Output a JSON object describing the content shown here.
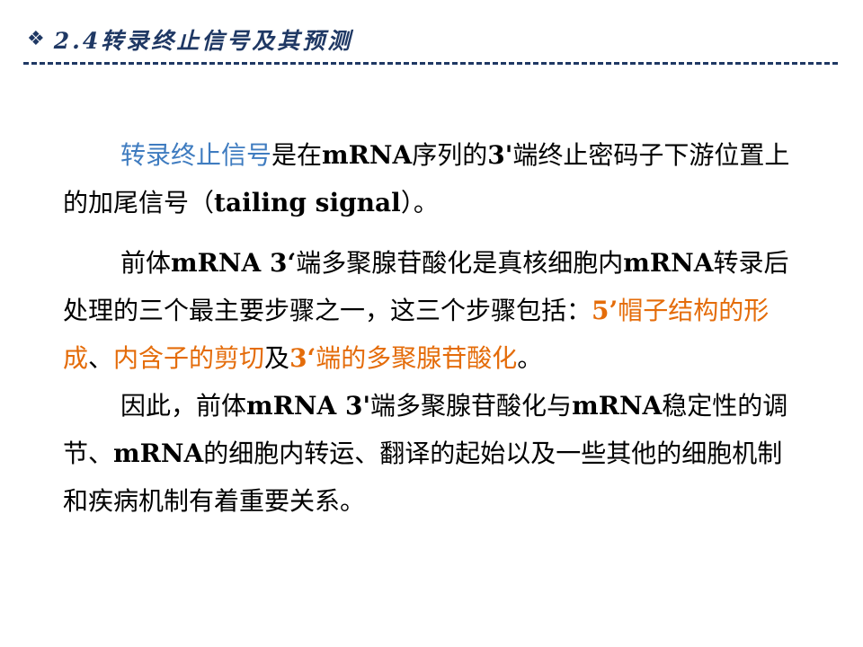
{
  "header": {
    "bullet_icon": "diamond-bullet-icon",
    "title": "2.4转录终止信号及其预测"
  },
  "colors": {
    "title": "#1F3864",
    "highlight_blue": "#3F7CC0",
    "highlight_orange": "#E46C0A"
  },
  "paragraphs": {
    "p1": {
      "term": "转录终止信号",
      "t1": "是在",
      "b1": "mRNA",
      "t2": "序列的",
      "b2": "3'",
      "t3": "端终止密码子下游位置上的加尾信号（",
      "b3": "tailing signal",
      "t4": "）。"
    },
    "p2": {
      "t1": "前体",
      "b1": "mRNA 3‘",
      "t2": "端多聚腺苷酸化是真核细胞内",
      "b2": "mRNA",
      "t3": "转录后处理的三个最主要步骤之一，这三个步骤包括：",
      "o1_bold": "5’",
      "o1": "帽子结构的形成",
      "t4": "、",
      "o2": "内含子的剪切",
      "t5": "及",
      "o3_bold": "3‘",
      "o3": "端的多聚腺苷酸化",
      "t6": "。"
    },
    "p3": {
      "t1": "因此，前体",
      "b1": "mRNA 3'",
      "t2": "端多聚腺苷酸化与",
      "b2": "mRNA",
      "t3": "稳定性的调节、",
      "b3": "mRNA",
      "t4": "的细胞内转运、翻译的起始以及一些其他的细胞机制和疾病机制有着重要关系。"
    }
  }
}
